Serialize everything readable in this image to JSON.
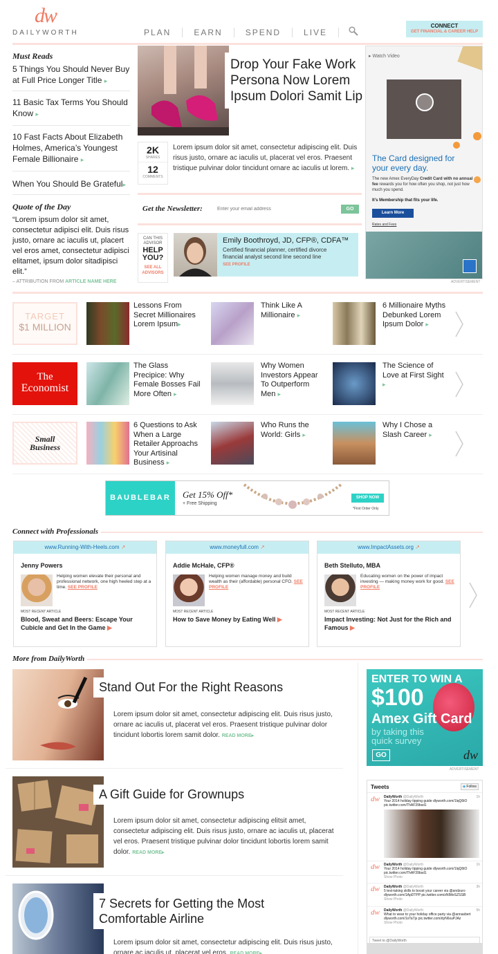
{
  "header": {
    "logo_mark": "dw",
    "brand": "DAILYWORTH",
    "nav": [
      "PLAN",
      "EARN",
      "SPEND",
      "LIVE"
    ],
    "connect_title": "CONNECT",
    "connect_sub": "GET FINANCIAL & CAREER HELP"
  },
  "must_reads": {
    "title": "Must Reads",
    "items": [
      "5 Things You Should Never Buy at Full Price Longer Title",
      "11 Basic Tax Terms You Should Know",
      "10 Fast Facts About Elizabeth Holmes, America’s Youngest Female Billionaire",
      "When You Should Be Grateful"
    ]
  },
  "quote": {
    "title": "Quote of the Day",
    "text": "“Lorem ipsum dolor sit amet, consectetur adipisci elit. Duis risus justo, ornare ac iaculis ut, placert vel eros amet, consectetur adipisci elitamet, ipsum dolor sitadipisci elit.”",
    "attr_prefix": "– ATTRIBUTION FROM",
    "attr_link": "ARTICLE NAME HERE"
  },
  "feature": {
    "title": "Drop Your Fake Work Persona Now Lorem Ipsum Dolori Samit Lip",
    "shares_count": "2K",
    "shares_label": "SHARES",
    "comments_count": "12",
    "comments_label": "COMMENTS",
    "body": "Lorem ipsum dolor sit amet, consectetur adipiscing elit. Duis risus justo, ornare ac iaculis ut, placerat vel eros. Praesent tristique pulvinar dolor tincidunt ornare ac iaculis ut lorem."
  },
  "newsletter": {
    "label": "Get the Newsletter:",
    "placeholder": "Enter your email address",
    "go": "GO"
  },
  "advisor": {
    "side_top": "CAN THIS ADVISOR",
    "side_big": "HELP YOU?",
    "side_link": "SEE ALL ADVISORS",
    "name": "Emily Boothroyd, JD, CFP®, CDFA™",
    "desc": "Certified financial planner, certified divorce financial analyst second line second line",
    "profile": "SEE PROFILE"
  },
  "side_ad": {
    "watch": "Watch Video",
    "headline": "The Card designed for your every day.",
    "line1_pre": "The new Amex EveryDay",
    "line1_bold": "Credit Card with",
    "line2_bold": "no annual fee",
    "line2_rest": " rewards you for how often you shop, not just how much you spend.",
    "membership": "It’s Membership that fits your life.",
    "learn": "Learn More",
    "rates": "Rates and Fees",
    "label": "ADVERTISEMENT"
  },
  "partners": [
    {
      "logo_lines": [
        "TARGET",
        "$1 MILLION"
      ],
      "items": [
        "Lessons From Secret Millionaires Lorem Ipsum",
        "Think Like A Millionaire",
        "6 Millionaire Myths Debunked Lorem Ipsum Dolor"
      ]
    },
    {
      "logo_lines": [
        "The",
        "Economist"
      ],
      "items": [
        "The Glass Precipice: Why Female Bosses Fail More Often",
        "Why Women Investors Appear To Outperform Men",
        "The Science of Love at First Sight"
      ]
    },
    {
      "logo_lines": [
        "Small",
        "Business"
      ],
      "items": [
        "6 Questions to Ask When a Large Retailer Approachs Your Artisinal Business",
        "Who Runs the World: Girls",
        "Why I Chose a Slash Career"
      ]
    }
  ],
  "banner": {
    "brand": "BAUBLEBAR",
    "offer": "Get 15% Off*",
    "shipping": "+ Free Shipping",
    "cta": "SHOP NOW",
    "fine": "*First Order Only"
  },
  "professionals": {
    "title": "Connect with Professionals",
    "cards": [
      {
        "site": "www.Running-With-Heels.com",
        "name": "Jenny Powers",
        "desc": "Helping women elevate their personal and professional network, one high heeled step at a time.",
        "profile": "SEE PROFILE",
        "recent_label": "MOST RECENT ARTICLE",
        "recent": "Blood, Sweat and Beers: Escape Your Cubicle and Get In the Game"
      },
      {
        "site": "www.moneyfull.com",
        "name": "Addie McHale, CFP®",
        "desc": "Helping women manage money and build wealth as their (affordable) personal CFO.",
        "profile": "SEE PROFILE",
        "recent_label": "MOST RECENT ARTICLE",
        "recent": "How to Save Money by Eating Well"
      },
      {
        "site": "www.ImpactAssets.org",
        "name": "Beth Stelluto, MBA",
        "desc": "Educating women on the power of impact investing — making money work for good.",
        "profile": "SEE PROFILE",
        "recent_label": "MOST RECENT ARTICLE",
        "recent": "Impact Investing: Not Just for the Rich and Famous"
      }
    ]
  },
  "more": {
    "title": "More from DailyWorth",
    "read_more": "READ MORE",
    "articles": [
      {
        "title": "Stand Out For the Right Reasons",
        "body": "Lorem ipsum dolor sit amet, consectetur adipiscing elit. Duis risus justo, ornare ac iaculis ut, placerat vel eros. Praesent tristique pulvinar dolor tincidunt lobortis lorem samit dolor."
      },
      {
        "title": "A Gift Guide for Grownups",
        "body": "Lorem ipsum dolor sit amet, consectetur adipiscing elitsit amet, consectetur adipiscing elit. Duis risus justo, ornare ac iaculis ut, placerat vel eros. Praesent tristique pulvinar dolor tincidunt lobortis lorem samit dolor."
      },
      {
        "title": "7 Secrets for Getting the Most Comfortable Airline",
        "body": "Lorem ipsum dolor sit amet, consectetur adipiscing elit. Duis risus justo, ornare ac iaculis ut, placerat vel eros."
      }
    ]
  },
  "promo": {
    "l1": "ENTER TO WIN A",
    "l2": "$100",
    "l3": "Amex Gift Card",
    "l4": "by taking this quick survey",
    "go": "GO",
    "logo": "dw",
    "label": "ADVERTISEMENT"
  },
  "tweets": {
    "title": "Tweets",
    "follow": "Follow",
    "items": [
      {
        "user": "DailyWorth",
        "handle": "@DailyWorth",
        "text": "Your 2014 holiday tipping guide dlyworth.com/1lqQ6tO pic.twitter.com/ThAF39bsd1",
        "time": "1h"
      },
      {
        "user": "DailyWorth",
        "handle": "@DailyWorth",
        "text": "Your 2014 holiday tipping guide dlyworth.com/1lqQ6tO pic.twitter.com/ThAF39bsd1",
        "time": "1h",
        "show": "Show Photo"
      },
      {
        "user": "DailyWorth",
        "handle": "@DailyWorth",
        "text": "5 test-taking skills to boost your career via @andzuro dlyworth.com/1ApDTPP pic.twitter.com/zNIMeSZSSB",
        "time": "3h",
        "show": "Show Photo"
      },
      {
        "user": "DailyWorth",
        "handle": "@DailyWorth",
        "text": "What to wear to your holiday office party via @annasbert dlyworth.com/1oTaTjs pic.twitter.com/dyN6xuPJAz",
        "time": "5h",
        "show": "Show Photo"
      }
    ],
    "compose": "Tweet to @DailyWorth"
  }
}
